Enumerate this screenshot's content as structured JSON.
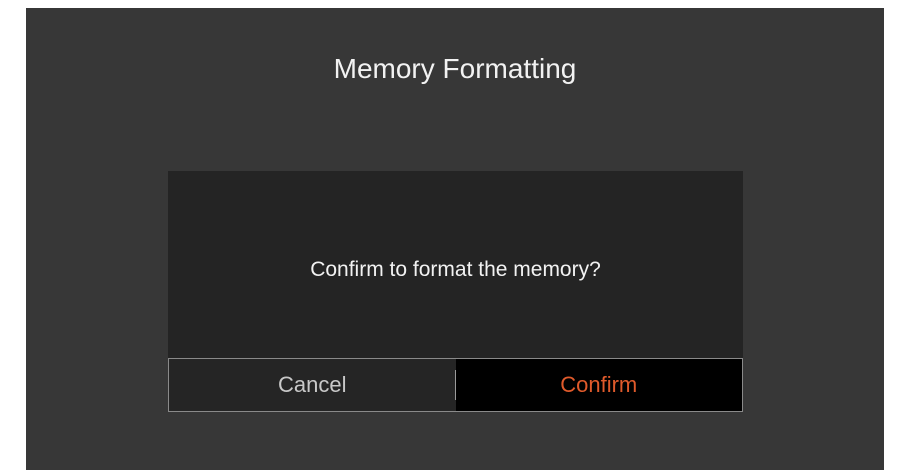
{
  "header": {
    "title": "Memory Formatting"
  },
  "dialog": {
    "message": "Confirm to format the memory?",
    "cancel_label": "Cancel",
    "confirm_label": "Confirm"
  },
  "colors": {
    "screen_bg": "#373737",
    "dialog_bg": "#242424",
    "confirm_accent": "#e05a2b",
    "text": "#f2f2f2"
  }
}
